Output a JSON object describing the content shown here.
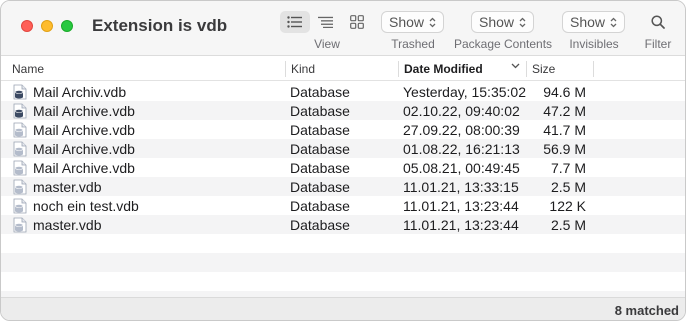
{
  "window": {
    "title": "Extension is vdb"
  },
  "toolbar": {
    "view_label": "View",
    "view_modes": [
      "list-view-icon",
      "outline-view-icon",
      "grid-view-icon"
    ],
    "trashed": {
      "value": "Show",
      "label": "Trashed"
    },
    "package_contents": {
      "value": "Show",
      "label": "Package Contents"
    },
    "invisibles": {
      "value": "Show",
      "label": "Invisibles"
    },
    "filter_label": "Filter"
  },
  "columns": {
    "name": "Name",
    "kind": "Kind",
    "date_modified": "Date Modified",
    "size": "Size",
    "sorted_by": "date_modified",
    "sort_direction": "descending"
  },
  "files": [
    {
      "name": "Mail Archiv.vdb",
      "kind": "Database",
      "date": "Yesterday, 15:35:02",
      "size": "94.6 M",
      "icon": "dark-database-file-icon"
    },
    {
      "name": "Mail Archive.vdb",
      "kind": "Database",
      "date": "02.10.22, 09:40:02",
      "size": "47.2 M",
      "icon": "dark-database-file-icon"
    },
    {
      "name": "Mail Archive.vdb",
      "kind": "Database",
      "date": "27.09.22, 08:00:39",
      "size": "41.7 M",
      "icon": "light-database-file-icon"
    },
    {
      "name": "Mail Archive.vdb",
      "kind": "Database",
      "date": "01.08.22, 16:21:13",
      "size": "56.9 M",
      "icon": "light-database-file-icon"
    },
    {
      "name": "Mail Archive.vdb",
      "kind": "Database",
      "date": "05.08.21, 00:49:45",
      "size": "7.7 M",
      "icon": "light-database-file-icon"
    },
    {
      "name": "master.vdb",
      "kind": "Database",
      "date": "11.01.21, 13:33:15",
      "size": "2.5 M",
      "icon": "light-database-file-icon"
    },
    {
      "name": "noch ein test.vdb",
      "kind": "Database",
      "date": "11.01.21, 13:23:44",
      "size": "122 K",
      "icon": "light-database-file-icon"
    },
    {
      "name": "master.vdb",
      "kind": "Database",
      "date": "11.01.21, 13:23:44",
      "size": "2.5 M",
      "icon": "light-database-file-icon"
    }
  ],
  "status": {
    "matched": "8 matched"
  },
  "colors": {
    "close": "#ff5f57",
    "minimize": "#febc2e",
    "maximize": "#28c840",
    "row_stripe": "#f4f4f5",
    "icon_dark": "#3c4a63",
    "icon_light": "#b4bccb"
  }
}
